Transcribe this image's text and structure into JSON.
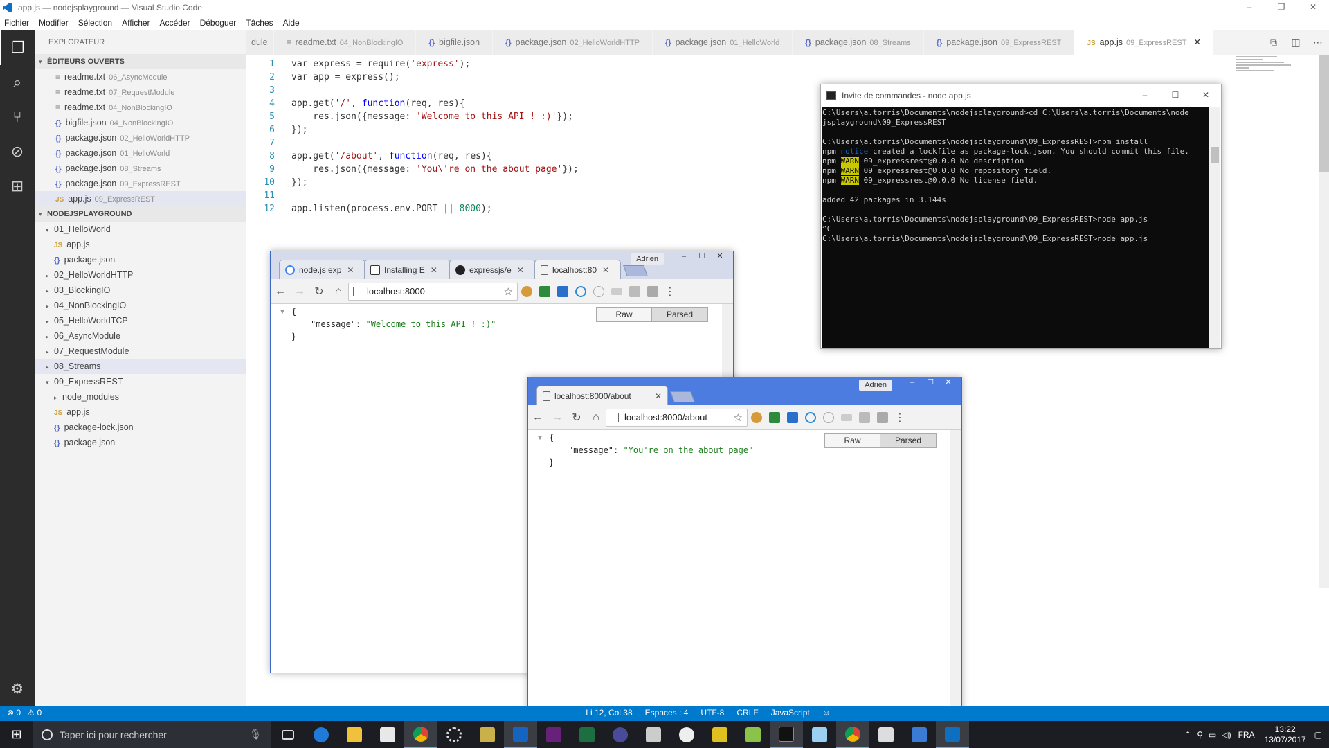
{
  "window": {
    "title": "app.js — nodejsplayground — Visual Studio Code",
    "controls": [
      "–",
      "❐",
      "✕"
    ]
  },
  "menu": [
    "Fichier",
    "Modifier",
    "Sélection",
    "Afficher",
    "Accéder",
    "Déboguer",
    "Tâches",
    "Aide"
  ],
  "sidebar": {
    "title": "EXPLORATEUR",
    "open_editors_label": "ÉDITEURS OUVERTS",
    "open_editors": [
      {
        "icon": "txt",
        "name": "readme.txt",
        "path": "06_AsyncModule"
      },
      {
        "icon": "txt",
        "name": "readme.txt",
        "path": "07_RequestModule"
      },
      {
        "icon": "txt",
        "name": "readme.txt",
        "path": "04_NonBlockingIO"
      },
      {
        "icon": "json",
        "name": "bigfile.json",
        "path": "04_NonBlockingIO"
      },
      {
        "icon": "json",
        "name": "package.json",
        "path": "02_HelloWorldHTTP"
      },
      {
        "icon": "json",
        "name": "package.json",
        "path": "01_HelloWorld"
      },
      {
        "icon": "json",
        "name": "package.json",
        "path": "08_Streams"
      },
      {
        "icon": "json",
        "name": "package.json",
        "path": "09_ExpressREST"
      },
      {
        "icon": "js",
        "name": "app.js",
        "path": "09_ExpressREST"
      }
    ],
    "project_label": "NODEJSPLAYGROUND",
    "tree": [
      {
        "twisty": "▾",
        "name": "01_HelloWorld",
        "depth": 0
      },
      {
        "icon": "js",
        "name": "app.js",
        "depth": 1
      },
      {
        "icon": "json",
        "name": "package.json",
        "depth": 1
      },
      {
        "twisty": "▸",
        "name": "02_HelloWorldHTTP",
        "depth": 0
      },
      {
        "twisty": "▸",
        "name": "03_BlockingIO",
        "depth": 0
      },
      {
        "twisty": "▸",
        "name": "04_NonBlockingIO",
        "depth": 0
      },
      {
        "twisty": "▸",
        "name": "05_HelloWorldTCP",
        "depth": 0
      },
      {
        "twisty": "▸",
        "name": "06_AsyncModule",
        "depth": 0
      },
      {
        "twisty": "▸",
        "name": "07_RequestModule",
        "depth": 0
      },
      {
        "twisty": "▸",
        "name": "08_Streams",
        "depth": 0
      },
      {
        "twisty": "▾",
        "name": "09_ExpressREST",
        "depth": 0
      },
      {
        "twisty": "▸",
        "name": "node_modules",
        "depth": 1
      },
      {
        "icon": "js",
        "name": "app.js",
        "depth": 1
      },
      {
        "icon": "json",
        "name": "package-lock.json",
        "depth": 1
      },
      {
        "icon": "json",
        "name": "package.json",
        "depth": 1
      }
    ]
  },
  "tabs": [
    {
      "icon": "",
      "name": "dule",
      "path": ""
    },
    {
      "icon": "txt",
      "name": "readme.txt",
      "path": "04_NonBlockingIO"
    },
    {
      "icon": "json",
      "name": "bigfile.json",
      "path": ""
    },
    {
      "icon": "json",
      "name": "package.json",
      "path": "02_HelloWorldHTTP"
    },
    {
      "icon": "json",
      "name": "package.json",
      "path": "01_HelloWorld"
    },
    {
      "icon": "json",
      "name": "package.json",
      "path": "08_Streams"
    },
    {
      "icon": "json",
      "name": "package.json",
      "path": "09_ExpressREST"
    },
    {
      "icon": "js",
      "name": "app.js",
      "path": "09_ExpressREST",
      "active": true
    }
  ],
  "code": [
    [
      [
        "",
        "var express = require("
      ],
      [
        "str",
        "'express'"
      ],
      [
        "",
        ");"
      ]
    ],
    [
      [
        "",
        "var app = express();"
      ]
    ],
    [],
    [
      [
        "",
        "app.get("
      ],
      [
        "str",
        "'/'"
      ],
      [
        "",
        ", "
      ],
      [
        "kw",
        "function"
      ],
      [
        "",
        "(req, res){"
      ]
    ],
    [
      [
        "",
        "    res.json({message: "
      ],
      [
        "str",
        "'Welcome to this API ! :)'"
      ],
      [
        "",
        "});"
      ]
    ],
    [
      [
        "",
        "});"
      ]
    ],
    [],
    [
      [
        "",
        "app.get("
      ],
      [
        "str",
        "'/about'"
      ],
      [
        "",
        ", "
      ],
      [
        "kw",
        "function"
      ],
      [
        "",
        "(req, res){"
      ]
    ],
    [
      [
        "",
        "    res.json({message: "
      ],
      [
        "str",
        "'You\\'re on the about page'"
      ],
      [
        "",
        "});"
      ]
    ],
    [
      [
        "",
        "});"
      ]
    ],
    [],
    [
      [
        "",
        "app.listen(process.env.PORT || "
      ],
      [
        "num",
        "8000"
      ],
      [
        "",
        ");"
      ]
    ]
  ],
  "cmd": {
    "title": "Invite de commandes - node  app.js",
    "lines": [
      [
        [
          "",
          "C:\\Users\\a.torris\\Documents\\nodejsplayground>cd C:\\Users\\a.torris\\Documents\\node"
        ]
      ],
      [
        [
          "",
          "jsplayground\\09_ExpressREST"
        ]
      ],
      [
        [
          "",
          ""
        ]
      ],
      [
        [
          "",
          "C:\\Users\\a.torris\\Documents\\nodejsplayground\\09_ExpressREST>npm install"
        ]
      ],
      [
        [
          "",
          "npm "
        ],
        [
          "notice",
          "notice"
        ],
        [
          "",
          " created a lockfile as package-lock.json. You should commit this file."
        ]
      ],
      [
        [
          "",
          "npm "
        ],
        [
          "warn",
          "WARN"
        ],
        [
          "",
          " 09_expressrest@0.0.0 No description"
        ]
      ],
      [
        [
          "",
          "npm "
        ],
        [
          "warn",
          "WARN"
        ],
        [
          "",
          " 09_expressrest@0.0.0 No repository field."
        ]
      ],
      [
        [
          "",
          "npm "
        ],
        [
          "warn",
          "WARN"
        ],
        [
          "",
          " 09_expressrest@0.0.0 No license field."
        ]
      ],
      [
        [
          "",
          ""
        ]
      ],
      [
        [
          "",
          "added 42 packages in 3.144s"
        ]
      ],
      [
        [
          "",
          ""
        ]
      ],
      [
        [
          "",
          "C:\\Users\\a.torris\\Documents\\nodejsplayground\\09_ExpressREST>node app.js"
        ]
      ],
      [
        [
          "",
          "^C"
        ]
      ],
      [
        [
          "",
          "C:\\Users\\a.torris\\Documents\\nodejsplayground\\09_ExpressREST>node app.js"
        ]
      ]
    ]
  },
  "chrome1": {
    "user": "Adrien",
    "tabs": [
      "node.js exp",
      "Installing E",
      "expressjs/e",
      "localhost:80"
    ],
    "url": "localhost:8000",
    "raw": "Raw",
    "parsed": "Parsed",
    "json_key": "\"message\"",
    "json_value": "\"Welcome to this API ! :)\""
  },
  "chrome2": {
    "user": "Adrien",
    "tab": "localhost:8000/about",
    "url": "localhost:8000/about",
    "raw": "Raw",
    "parsed": "Parsed",
    "json_key": "\"message\"",
    "json_value": "\"You're on the about page\""
  },
  "status": {
    "errors": "⊗ 0",
    "warnings": "⚠ 0",
    "position": "Li 12, Col 38",
    "spaces": "Espaces : 4",
    "encoding": "UTF-8",
    "eol": "CRLF",
    "language": "JavaScript"
  },
  "taskbar": {
    "search_placeholder": "Taper ici pour rechercher",
    "lang": "FRA",
    "time": "13:22",
    "date": "13/07/2017"
  }
}
